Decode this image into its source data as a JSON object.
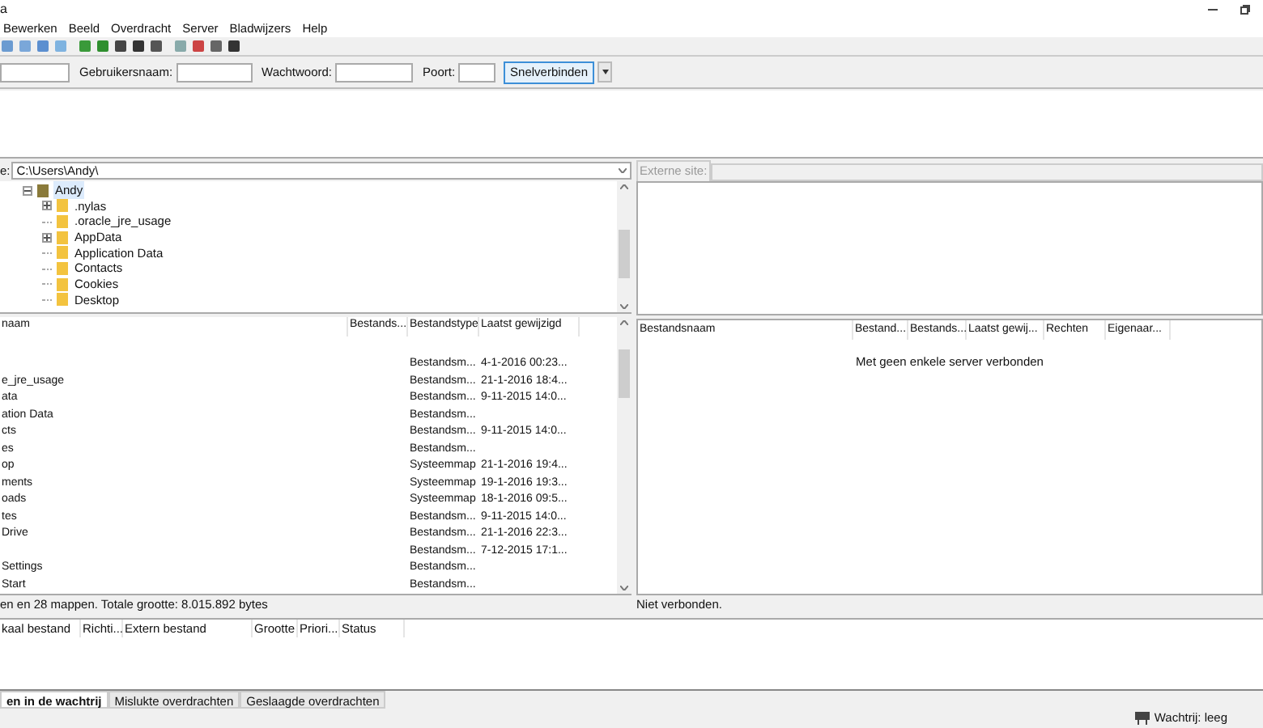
{
  "window": {
    "title": "a"
  },
  "menu": [
    "Bewerken",
    "Beeld",
    "Overdracht",
    "Server",
    "Bladwijzers",
    "Help"
  ],
  "quickconnect": {
    "fields": [
      {
        "label": "Gebruikersnaam:"
      },
      {
        "label": "Wachtwoord:"
      },
      {
        "label": "Poort:"
      }
    ],
    "button": "Snelverbinden"
  },
  "local": {
    "site_label": "e:",
    "path": "C:\\Users\\Andy\\",
    "tree": [
      {
        "name": "Andy",
        "expanded": true,
        "selected": true,
        "children": [
          {
            "name": ".nylas",
            "expandable": true
          },
          {
            "name": ".oracle_jre_usage",
            "expandable": false
          },
          {
            "name": "AppData",
            "expandable": true
          },
          {
            "name": "Application Data",
            "expandable": false
          },
          {
            "name": "Contacts",
            "expandable": false
          },
          {
            "name": "Cookies",
            "expandable": false
          },
          {
            "name": "Desktop",
            "expandable": false
          }
        ]
      }
    ],
    "columns": [
      "naam",
      "Bestands...",
      "Bestandstype",
      "Laatst gewijzigd"
    ],
    "rows": [
      [
        "",
        "",
        "",
        ""
      ],
      [
        "",
        "",
        "Bestandsm...",
        "4-1-2016 00:23..."
      ],
      [
        "e_jre_usage",
        "",
        "Bestandsm...",
        "21-1-2016 18:4..."
      ],
      [
        "ata",
        "",
        "Bestandsm...",
        "9-11-2015 14:0..."
      ],
      [
        "ation Data",
        "",
        "Bestandsm...",
        ""
      ],
      [
        "cts",
        "",
        "Bestandsm...",
        "9-11-2015 14:0..."
      ],
      [
        "es",
        "",
        "Bestandsm...",
        ""
      ],
      [
        "op",
        "",
        "Systeemmap",
        "21-1-2016 19:4..."
      ],
      [
        "ments",
        "",
        "Systeemmap",
        "19-1-2016 19:3..."
      ],
      [
        "oads",
        "",
        "Systeemmap",
        "18-1-2016 09:5..."
      ],
      [
        "tes",
        "",
        "Bestandsm...",
        "9-11-2015 14:0..."
      ],
      [
        " Drive",
        "",
        "Bestandsm...",
        "21-1-2016 22:3..."
      ],
      [
        "",
        "",
        "Bestandsm...",
        "7-12-2015 17:1..."
      ],
      [
        "Settings",
        "",
        "Bestandsm...",
        ""
      ],
      [
        "Start",
        "",
        "Bestandsm...",
        ""
      ]
    ],
    "status": "en en 28 mappen. Totale grootte: 8.015.892 bytes"
  },
  "remote": {
    "site_label": "Externe site:",
    "columns": [
      "Bestandsnaam",
      "Bestand...",
      "Bestands...",
      "Laatst gewij...",
      "Rechten",
      "Eigenaar..."
    ],
    "empty_message": "Met geen enkele server verbonden",
    "status": "Niet verbonden."
  },
  "queue": {
    "columns": [
      "kaal bestand",
      "Richti...",
      "Extern bestand",
      "Grootte",
      "Priori...",
      "Status"
    ],
    "tabs": [
      {
        "label": "en in de wachtrij",
        "selected": true
      },
      {
        "label": "Mislukte overdrachten",
        "selected": false
      },
      {
        "label": "Geslaagde overdrachten",
        "selected": false
      }
    ]
  },
  "status_bar": {
    "queue": "Wachtrij: leeg"
  }
}
